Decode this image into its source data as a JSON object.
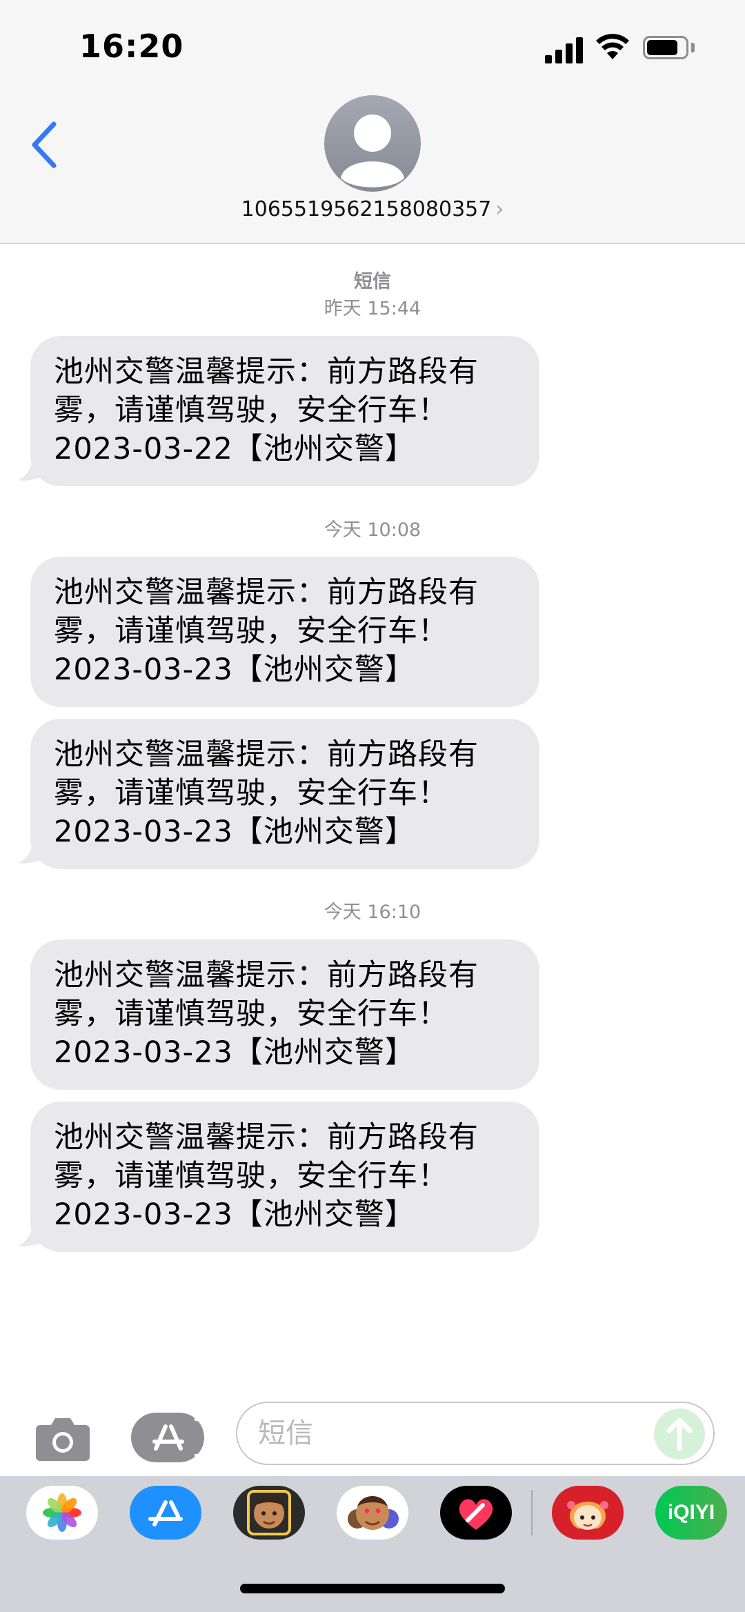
{
  "status_bar": {
    "time": "16:20"
  },
  "header": {
    "contact_number": "1065519562158080357",
    "chevron": "›"
  },
  "messages": {
    "groups": [
      {
        "service": "短信",
        "timestamp": "昨天 15:44",
        "bubbles": [
          {
            "line1": "池州交警温馨提示：前方路段有",
            "line2": "雾，请谨慎驾驶，安全行车！",
            "line3": "2023-03-22【池州交警】"
          }
        ]
      },
      {
        "timestamp": "今天 10:08",
        "bubbles": [
          {
            "line1": "池州交警温馨提示：前方路段有",
            "line2": "雾，请谨慎驾驶，安全行车！",
            "line3": "2023-03-23【池州交警】"
          },
          {
            "line1": "池州交警温馨提示：前方路段有",
            "line2": "雾，请谨慎驾驶，安全行车！",
            "line3": "2023-03-23【池州交警】"
          }
        ]
      },
      {
        "timestamp": "今天 16:10",
        "bubbles": [
          {
            "line1": "池州交警温馨提示：前方路段有",
            "line2": "雾，请谨慎驾驶，安全行车！",
            "line3": "2023-03-23【池州交警】"
          },
          {
            "line1": "池州交警温馨提示：前方路段有",
            "line2": "雾，请谨慎驾驶，安全行车！",
            "line3": "2023-03-23【池州交警】"
          }
        ]
      }
    ]
  },
  "composer": {
    "placeholder": "短信"
  },
  "app_drawer": {
    "apps": [
      {
        "name": "photos-app",
        "icon": "photos-icon"
      },
      {
        "name": "app-store-app",
        "icon": "app-store-icon"
      },
      {
        "name": "memoji-camera-app",
        "icon": "memoji-camera-icon"
      },
      {
        "name": "memoji-stickers-app",
        "icon": "memoji-stickers-icon"
      },
      {
        "name": "digital-touch-app",
        "icon": "heart-icon"
      },
      {
        "name": "sticker-app",
        "icon": "girl-sticker-icon"
      },
      {
        "name": "iqiyi-app",
        "icon": "iqiyi-icon",
        "label": "iQIYI"
      }
    ]
  },
  "colors": {
    "bubble": "#e9e9eb",
    "accent": "#3478f6",
    "header_bg": "#f6f6f7"
  }
}
